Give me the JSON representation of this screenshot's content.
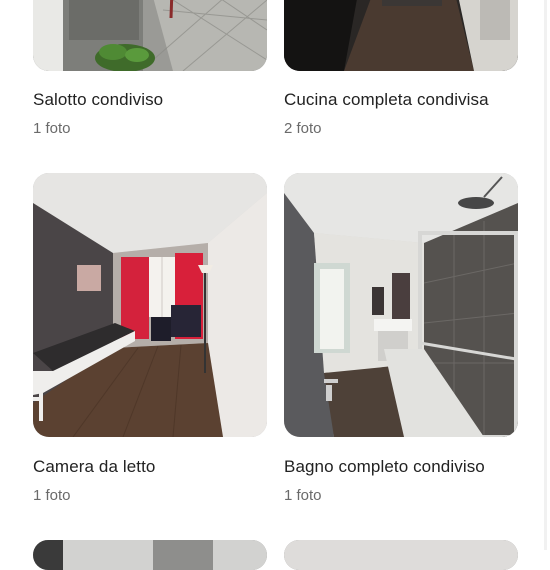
{
  "rooms": [
    {
      "title": "Salotto condiviso",
      "count": "1 foto",
      "photo": "living-room-photo"
    },
    {
      "title": "Cucina completa condivisa",
      "count": "2 foto",
      "photo": "kitchen-photo"
    },
    {
      "title": "Camera da letto",
      "count": "1 foto",
      "photo": "bedroom-photo"
    },
    {
      "title": "Bagno completo condiviso",
      "count": "1 foto",
      "photo": "bathroom-photo"
    },
    {
      "title": "",
      "count": "",
      "photo": "room-photo"
    },
    {
      "title": "",
      "count": "",
      "photo": "room-photo"
    }
  ]
}
